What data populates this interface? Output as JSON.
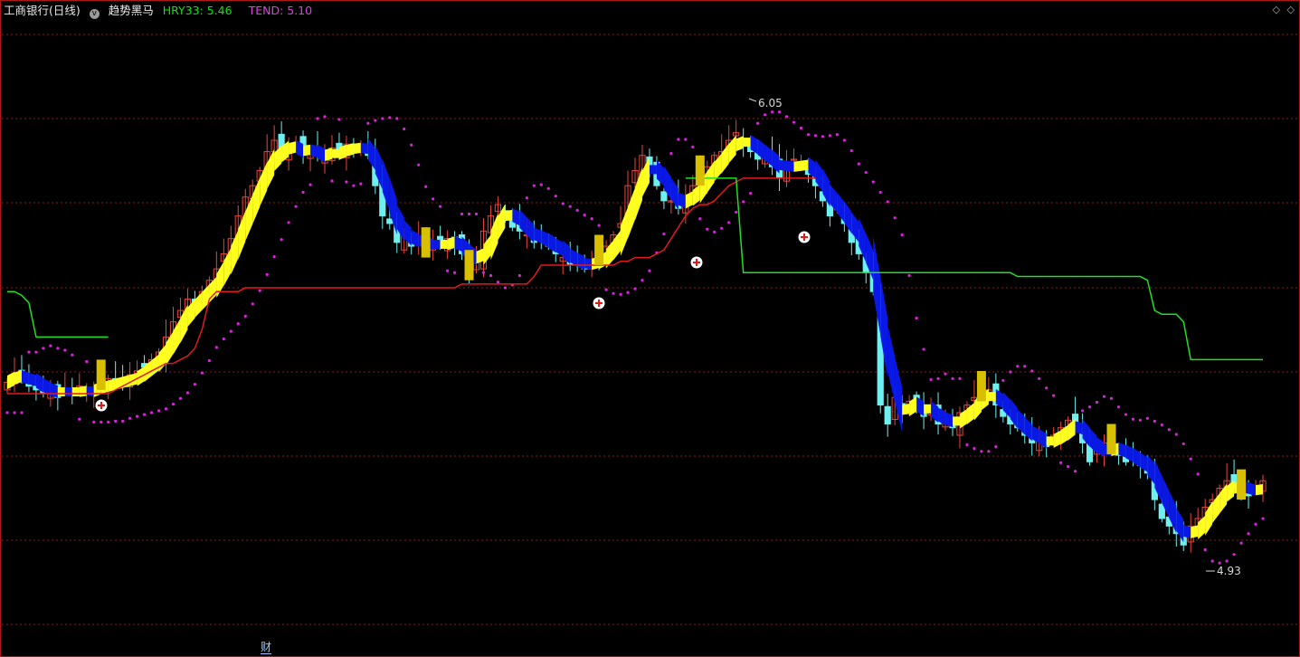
{
  "header": {
    "title": "工商银行(日线)",
    "indicator_icon": "v",
    "indicator_name": "趋势黑马",
    "hry_label": "HRY33: 5.46",
    "tend_label": "TEND: 5.10"
  },
  "footer": {
    "cai_label": "财"
  },
  "colors": {
    "background": "#000000",
    "frame": "#b01818",
    "grid": "#8a1a1a",
    "up_candle": "#e8463c",
    "down_candle": "#6ef0f0",
    "band_up": "#ffff20",
    "band_down": "#0a18e6",
    "red_line": "#e21a1a",
    "green_line": "#20e020",
    "dots": "#e020e0",
    "gold_bar": "#d8c000"
  },
  "chart_data": {
    "type": "candlestick",
    "title": "工商银行(日线)",
    "ylim": [
      4.72,
      6.28
    ],
    "max_label": "6.05",
    "min_label": "4.93",
    "x": [
      0,
      1,
      2,
      3,
      4,
      5,
      6,
      7,
      8,
      9,
      10,
      11,
      12,
      13,
      14,
      15,
      16,
      17,
      18,
      19,
      20,
      21,
      22,
      23,
      24,
      25,
      26,
      27,
      28,
      29,
      30,
      31,
      32,
      33,
      34,
      35,
      36,
      37,
      38,
      39,
      40,
      41,
      42,
      43,
      44,
      45,
      46,
      47,
      48,
      49,
      50,
      51,
      52,
      53,
      54,
      55,
      56,
      57,
      58,
      59,
      60,
      61,
      62,
      63,
      64,
      65,
      66,
      67,
      68,
      69,
      70,
      71,
      72,
      73,
      74,
      75,
      76,
      77,
      78,
      79,
      80,
      81,
      82,
      83,
      84,
      85,
      86,
      87,
      88,
      89,
      90,
      91,
      92,
      93,
      94,
      95,
      96,
      97,
      98,
      99,
      100,
      101,
      102,
      103,
      104,
      105,
      106,
      107,
      108,
      109,
      110,
      111,
      112,
      113,
      114,
      115,
      116,
      117,
      118,
      119,
      120,
      121,
      122,
      123,
      124,
      125,
      126,
      127,
      128,
      129,
      130,
      131,
      132,
      133,
      134,
      135,
      136,
      137,
      138,
      139,
      140,
      141,
      142,
      143,
      144,
      145,
      146,
      147,
      148,
      149,
      150,
      151,
      152,
      153,
      154,
      155,
      156,
      157,
      158,
      159,
      160,
      161,
      162,
      163,
      164,
      165,
      166,
      167,
      168,
      169,
      170,
      171,
      172,
      173,
      174
    ],
    "close": [
      5.36,
      5.38,
      5.39,
      5.35,
      5.34,
      5.33,
      5.35,
      5.32,
      5.34,
      5.33,
      5.35,
      5.33,
      5.34,
      5.36,
      5.37,
      5.35,
      5.36,
      5.38,
      5.39,
      5.4,
      5.42,
      5.44,
      5.48,
      5.52,
      5.55,
      5.58,
      5.57,
      5.6,
      5.63,
      5.66,
      5.7,
      5.74,
      5.8,
      5.85,
      5.88,
      5.92,
      5.97,
      6.0,
      5.96,
      5.98,
      5.99,
      5.96,
      5.97,
      5.96,
      5.95,
      5.98,
      5.97,
      5.99,
      5.97,
      5.99,
      5.96,
      5.88,
      5.8,
      5.78,
      5.73,
      5.75,
      5.72,
      5.74,
      5.71,
      5.73,
      5.72,
      5.74,
      5.73,
      5.7,
      5.65,
      5.68,
      5.76,
      5.8,
      5.83,
      5.81,
      5.77,
      5.76,
      5.75,
      5.73,
      5.74,
      5.72,
      5.7,
      5.69,
      5.67,
      5.68,
      5.66,
      5.68,
      5.69,
      5.72,
      5.75,
      5.78,
      5.88,
      5.92,
      5.96,
      5.93,
      5.88,
      5.84,
      5.84,
      5.82,
      5.85,
      5.88,
      5.9,
      5.93,
      5.96,
      5.97,
      6.0,
      6.02,
      5.99,
      5.97,
      5.95,
      5.96,
      5.93,
      5.9,
      5.94,
      5.95,
      5.94,
      5.91,
      5.88,
      5.84,
      5.8,
      5.82,
      5.78,
      5.73,
      5.7,
      5.65,
      5.6,
      5.3,
      5.25,
      5.32,
      5.28,
      5.31,
      5.3,
      5.27,
      5.28,
      5.25,
      5.26,
      5.24,
      5.28,
      5.3,
      5.32,
      5.33,
      5.34,
      5.3,
      5.27,
      5.25,
      5.24,
      5.22,
      5.2,
      5.21,
      5.19,
      5.22,
      5.24,
      5.26,
      5.25,
      5.2,
      5.15,
      5.18,
      5.2,
      5.19,
      5.17,
      5.15,
      5.16,
      5.14,
      5.12,
      5.05,
      5.0,
      4.98,
      4.96,
      4.93,
      4.98,
      5.0,
      5.03,
      5.05,
      5.08,
      5.1,
      5.09,
      5.07,
      5.06,
      5.08,
      5.1
    ],
    "series": [
      {
        "name": "HRY33",
        "kind": "band"
      },
      {
        "name": "TEND",
        "kind": "dots"
      }
    ],
    "red_line": [
      5.33,
      5.33,
      5.33,
      5.33,
      5.33,
      5.33,
      5.33,
      5.33,
      5.33,
      5.33,
      5.33,
      5.33,
      5.33,
      5.33,
      5.33,
      5.34,
      5.35,
      5.36,
      5.37,
      5.38,
      5.39,
      5.4,
      5.41,
      5.41,
      5.42,
      5.43,
      5.45,
      5.5,
      5.58,
      5.6,
      5.6,
      5.6,
      5.6,
      5.61,
      5.61,
      5.61,
      5.61,
      5.61,
      5.61,
      5.61,
      5.61,
      5.61,
      5.61,
      5.61,
      5.61,
      5.61,
      5.61,
      5.61,
      5.61,
      5.61,
      5.61,
      5.61,
      5.61,
      5.61,
      5.61,
      5.61,
      5.61,
      5.61,
      5.61,
      5.61,
      5.61,
      5.61,
      5.61,
      5.62,
      5.62,
      5.62,
      5.62,
      5.62,
      5.62,
      5.62,
      5.62,
      5.62,
      5.62,
      5.64,
      5.67,
      5.67,
      5.67,
      5.67,
      5.67,
      5.67,
      5.67,
      5.67,
      5.67,
      5.67,
      5.67,
      5.68,
      5.68,
      5.69,
      5.69,
      5.69,
      5.7,
      5.71,
      5.74,
      5.77,
      5.8,
      5.82,
      5.83,
      5.83,
      5.84,
      5.86,
      5.88,
      5.89,
      5.9,
      5.9,
      5.9,
      5.9,
      5.9,
      5.9,
      5.9,
      5.9,
      5.9,
      5.9,
      5.9
    ],
    "red_line_start": 0,
    "green_line": [
      5.6,
      5.6,
      5.59,
      5.57,
      5.48,
      5.48,
      5.48,
      5.48,
      5.48,
      5.48,
      5.48,
      5.48,
      5.48,
      5.48,
      5.48
    ],
    "green_line_late": [
      5.9,
      5.9,
      5.9,
      5.9,
      5.9,
      5.9,
      5.9,
      5.9,
      5.65,
      5.65,
      5.65,
      5.65,
      5.65,
      5.65,
      5.65,
      5.65,
      5.65,
      5.65,
      5.65,
      5.65,
      5.65,
      5.65,
      5.65,
      5.65,
      5.65,
      5.65,
      5.65,
      5.65,
      5.65,
      5.65,
      5.65,
      5.65,
      5.65,
      5.65,
      5.65,
      5.65,
      5.65,
      5.65,
      5.65,
      5.65,
      5.65,
      5.65,
      5.65,
      5.65,
      5.65,
      5.65,
      5.64,
      5.64,
      5.64,
      5.64,
      5.64,
      5.64,
      5.64,
      5.64,
      5.64,
      5.64,
      5.64,
      5.64,
      5.64,
      5.64,
      5.64,
      5.64,
      5.64,
      5.64,
      5.63,
      5.55,
      5.54,
      5.54,
      5.54,
      5.52,
      5.42,
      5.42,
      5.42,
      5.42,
      5.42,
      5.42,
      5.42,
      5.42,
      5.42,
      5.42,
      5.42
    ]
  }
}
